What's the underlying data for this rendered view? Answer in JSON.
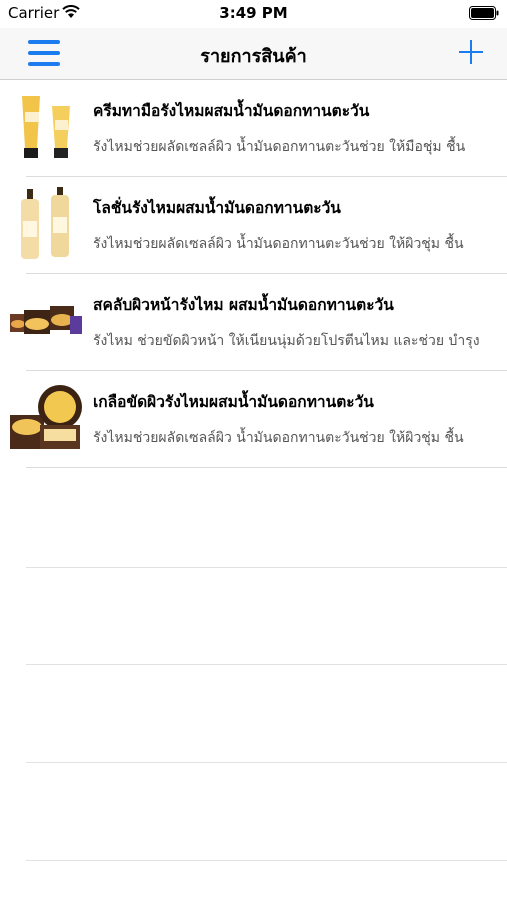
{
  "status_bar": {
    "carrier": "Carrier",
    "time": "3:49 PM",
    "icons": [
      "wifi-icon",
      "battery-icon"
    ]
  },
  "nav": {
    "title": "รายการสินค้า",
    "left_icon": "hamburger-menu-icon",
    "right_icon": "plus-icon",
    "accent_color": "#1b7cf0"
  },
  "products": [
    {
      "name": "ครีมทามือรังไหมผสมน้ำมันดอกทานตะวัน",
      "description": "รังไหมช่วยผลัดเซลล์ผิว น้ำมันดอกทานตะวันช่วย ให้มือชุ่ม ชื้น"
    },
    {
      "name": "โลชั่นรังไหมผสมน้ำมันดอกทานตะวัน",
      "description": "รังไหมช่วยผลัดเซลล์ผิว น้ำมันดอกทานตะวันช่วย ให้ผิวชุ่ม ชื้น"
    },
    {
      "name": "สคลับผิวหน้ารังไหม ผสมน้ำมันดอกทานตะวัน",
      "description": "รังไหม ช่วยขัดผิวหน้า ให้เนียนนุ่มด้วยโปรตีนไหม และช่วย บำรุง"
    },
    {
      "name": "เกลือขัดผิวรังไหมผสมน้ำมันดอกทานตะวัน",
      "description": "รังไหมช่วยผลัดเซลล์ผิว น้ำมันดอกทานตะวันช่วย ให้ผิวชุ่ม ชื้น"
    }
  ]
}
